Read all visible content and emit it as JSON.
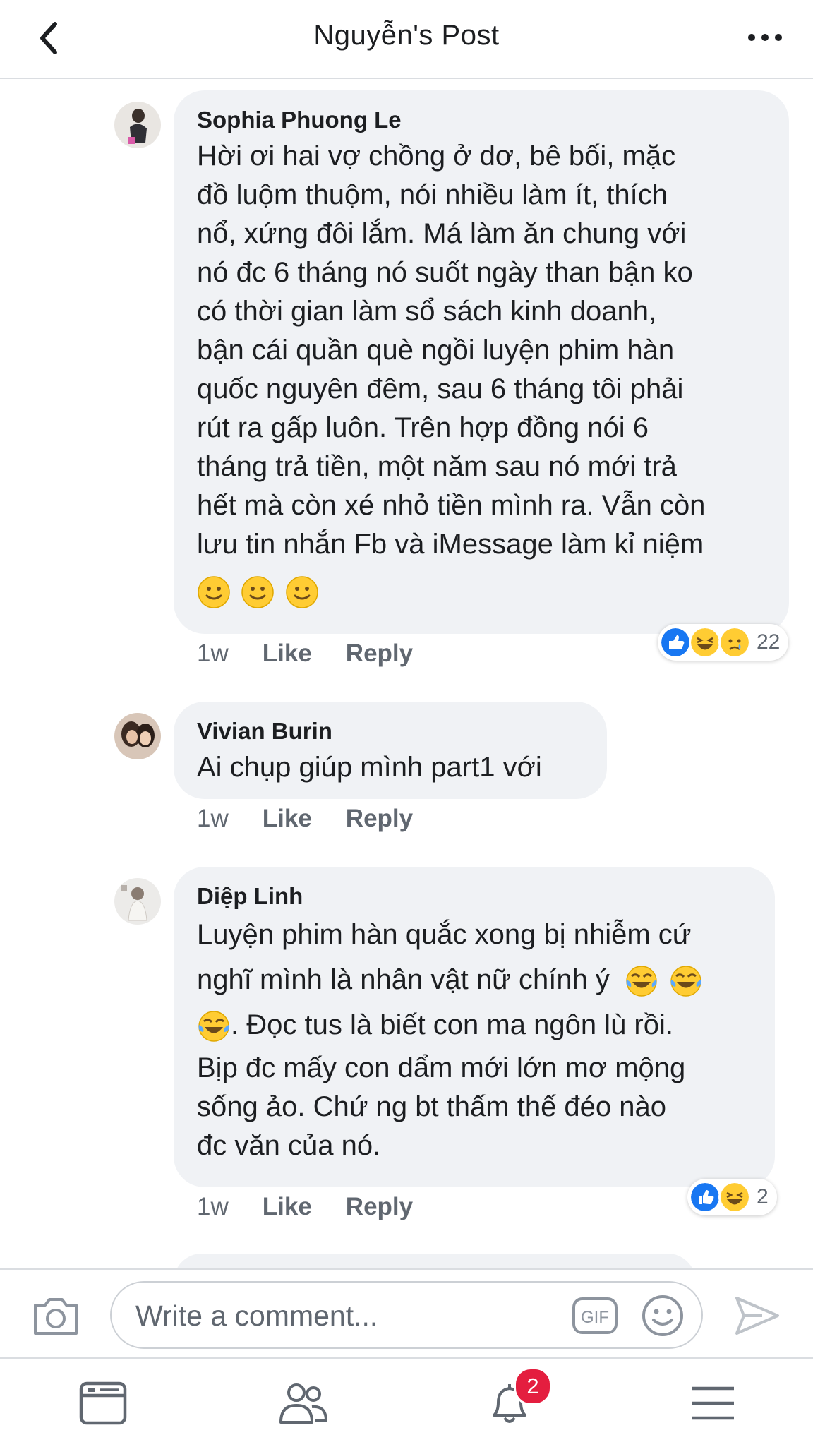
{
  "header": {
    "title": "Nguyễn's Post"
  },
  "comments": [
    {
      "author": "Sophia Phuong Le",
      "text": "Hời ơi hai vợ chồng ở dơ, bê bối, mặc\nđồ luộm thuộm, nói nhiều làm ít, thích\nnổ, xứng đôi lắm. Má làm ăn chung với\nnó đc 6 tháng nó suốt ngày than bận ko\ncó thời gian làm sổ sách kinh doanh,\nbận cái quần què ngồi luyện phim hàn\nquốc nguyên đêm, sau 6 tháng tôi phải\nrút ra gấp luôn. Trên hợp đồng nói 6\ntháng trả tiền, một năm sau nó mới trả\nhết mà còn xé nhỏ tiền mình ra. Vẫn còn\nlưu tin nhắn Fb và iMessage làm kỉ niệm",
      "emojis": [
        "slightly-smiling-face",
        "slightly-smiling-face",
        "slightly-smiling-face"
      ],
      "time": "1w",
      "like_label": "Like",
      "reply_label": "Reply",
      "reactions": [
        "like",
        "haha",
        "sad"
      ],
      "reaction_count": "22"
    },
    {
      "author": "Vivian Burin",
      "text": "Ai chụp giúp mình part1 với",
      "time": "1w",
      "like_label": "Like",
      "reply_label": "Reply"
    },
    {
      "author": "Diệp Linh",
      "text_line1": "Luyện phim hàn quắc xong bị nhiễm cứ",
      "text_line2": "nghĩ mình là nhân vật nữ chính ý",
      "text_line3": ". Đọc tus là biết con ma ngôn lù rồi.",
      "text_rest": "Bịp đc mấy con dẩm mới lớn mơ mộng\nsống ảo. Chứ ng bt thấm thế đéo nào\nđc văn của nó.",
      "emojis": [
        "tears-of-joy",
        "tears-of-joy",
        "tears-of-joy"
      ],
      "time": "1w",
      "like_label": "Like",
      "reply_label": "Reply",
      "reactions": [
        "like",
        "haha"
      ],
      "reaction_count": "2"
    }
  ],
  "composer": {
    "placeholder": "Write a comment...",
    "gif_label": "GIF"
  },
  "nav": {
    "items": [
      "news-feed",
      "friends",
      "notifications",
      "menu"
    ],
    "notification_badge": "2"
  },
  "colors": {
    "bubble": "#f0f2f5",
    "like_blue": "#1877f2",
    "badge_red": "#e41e3f",
    "emoji_yellow": "#ffcc33"
  }
}
